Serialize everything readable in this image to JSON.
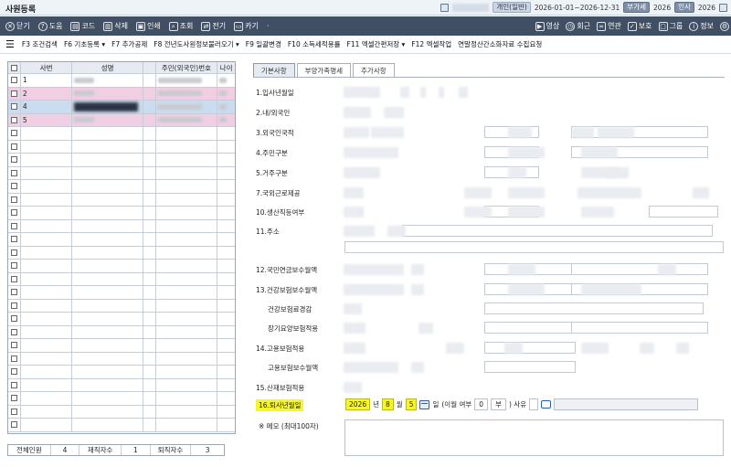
{
  "window": {
    "title": "사원등록",
    "badge_company": "개인(일반)",
    "period": "2026-01-01~2026-12-31",
    "badge_period": "부가세",
    "year1": "2026",
    "badge_insa": "인사",
    "year2": "2026"
  },
  "toolbar": {
    "left": [
      {
        "label": "닫기",
        "icon": "close-icon",
        "glyph": "✕"
      },
      {
        "label": "도움",
        "icon": "help-icon",
        "glyph": "?"
      },
      {
        "label": "코드",
        "icon": "code-icon",
        "glyph": "▤"
      },
      {
        "label": "삭제",
        "icon": "trash-icon",
        "glyph": "▥"
      },
      {
        "label": "인쇄",
        "icon": "print-icon",
        "glyph": "▣"
      },
      {
        "label": "조회",
        "icon": "search-icon",
        "glyph": "⌕"
      },
      {
        "label": "전기",
        "icon": "transfer-icon",
        "glyph": "⇄"
      },
      {
        "label": "카기",
        "icon": "card-icon",
        "glyph": "▭"
      }
    ],
    "more": "·",
    "right": [
      {
        "label": "영상",
        "icon": "video-icon",
        "glyph": "▶"
      },
      {
        "label": "회근",
        "icon": "clock-icon",
        "glyph": "◷"
      },
      {
        "label": "연관",
        "icon": "link-icon",
        "glyph": "∞"
      },
      {
        "label": "보호",
        "icon": "shield-icon",
        "glyph": "✓"
      },
      {
        "label": "그룹",
        "icon": "folder-icon",
        "glyph": "▢"
      },
      {
        "label": "정보",
        "icon": "info-icon",
        "glyph": "i"
      }
    ]
  },
  "subbar": [
    "F3 조건검색",
    "F6 기초등록 ▾",
    "F7 추가공제",
    "F8 전년도사원정보불러오기 ▾",
    "F9 일괄변경",
    "F10 소득세적용률",
    "F11 엑셀간편저장 ▾",
    "F12 엑셀작업",
    "연말정산간소화자료 수집요청"
  ],
  "grid": {
    "headers": [
      "",
      "사번",
      "성명",
      "주민(외국인)번호",
      "나이"
    ],
    "rows": [
      {
        "no": "1",
        "style": "normal"
      },
      {
        "no": "2",
        "style": "pink"
      },
      {
        "no": "4",
        "style": "blue"
      },
      {
        "no": "5",
        "style": "pink"
      }
    ],
    "empty_rows": 23
  },
  "summary": {
    "total_label": "전체인원",
    "total_value": "4",
    "active_label": "재직자수",
    "active_value": "1",
    "retired_label": "퇴직자수",
    "retired_value": "3"
  },
  "tabs": [
    "기본사항",
    "부양가족명세",
    "추가사항"
  ],
  "form": {
    "fields": [
      "1.입사년월일",
      "2.내/외국인",
      "3.외국인국적",
      "4.주민구분",
      "5.거주구분",
      "7.국외근로제공",
      "10.생산직등여부",
      "11.주소",
      "12.국민연금보수월액",
      "13.건강보험보수월액",
      "건강보험료경감",
      "장기요양보험적용",
      "14.고용보험적용",
      "고용보험보수월액",
      "15.산재보험적용"
    ],
    "retire_label": "16.퇴사년월일",
    "retire_year": "2026",
    "year_unit": "년",
    "retire_month": "8",
    "month_unit": "월",
    "retire_day": "5",
    "day_unit": "일",
    "unpaid_label": "(이월 여부",
    "unpaid_value": "0",
    "unpaid_text": "부",
    "reason_label": ")  사유",
    "memo_label": "※ 메모 (최대100자)"
  }
}
